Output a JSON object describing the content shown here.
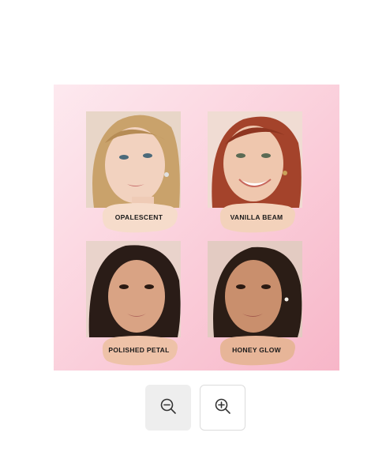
{
  "product_image": {
    "alt": "Four shade swatches with models",
    "shades": [
      {
        "name": "OPALESCENT",
        "skin": "#f2d2bf",
        "hair": "#c9a26b",
        "swatch": "#f6dccb"
      },
      {
        "name": "VANILLA BEAM",
        "skin": "#efc7ae",
        "hair": "#a4432b",
        "swatch": "#f3d2bb"
      },
      {
        "name": "POLISHED PETAL",
        "skin": "#d9a384",
        "hair": "#2a1c17",
        "swatch": "#eec2a8"
      },
      {
        "name": "HONEY GLOW",
        "skin": "#c98f6d",
        "hair": "#2b1d16",
        "swatch": "#e7b598"
      }
    ]
  },
  "zoom": {
    "out_icon": "zoom-out-icon",
    "in_icon": "zoom-in-icon"
  },
  "colors": {
    "background_pink_light": "#fde9ef",
    "background_pink_deep": "#f7b6c8",
    "button_gray": "#eeeeee",
    "icon_dark": "#333333"
  }
}
